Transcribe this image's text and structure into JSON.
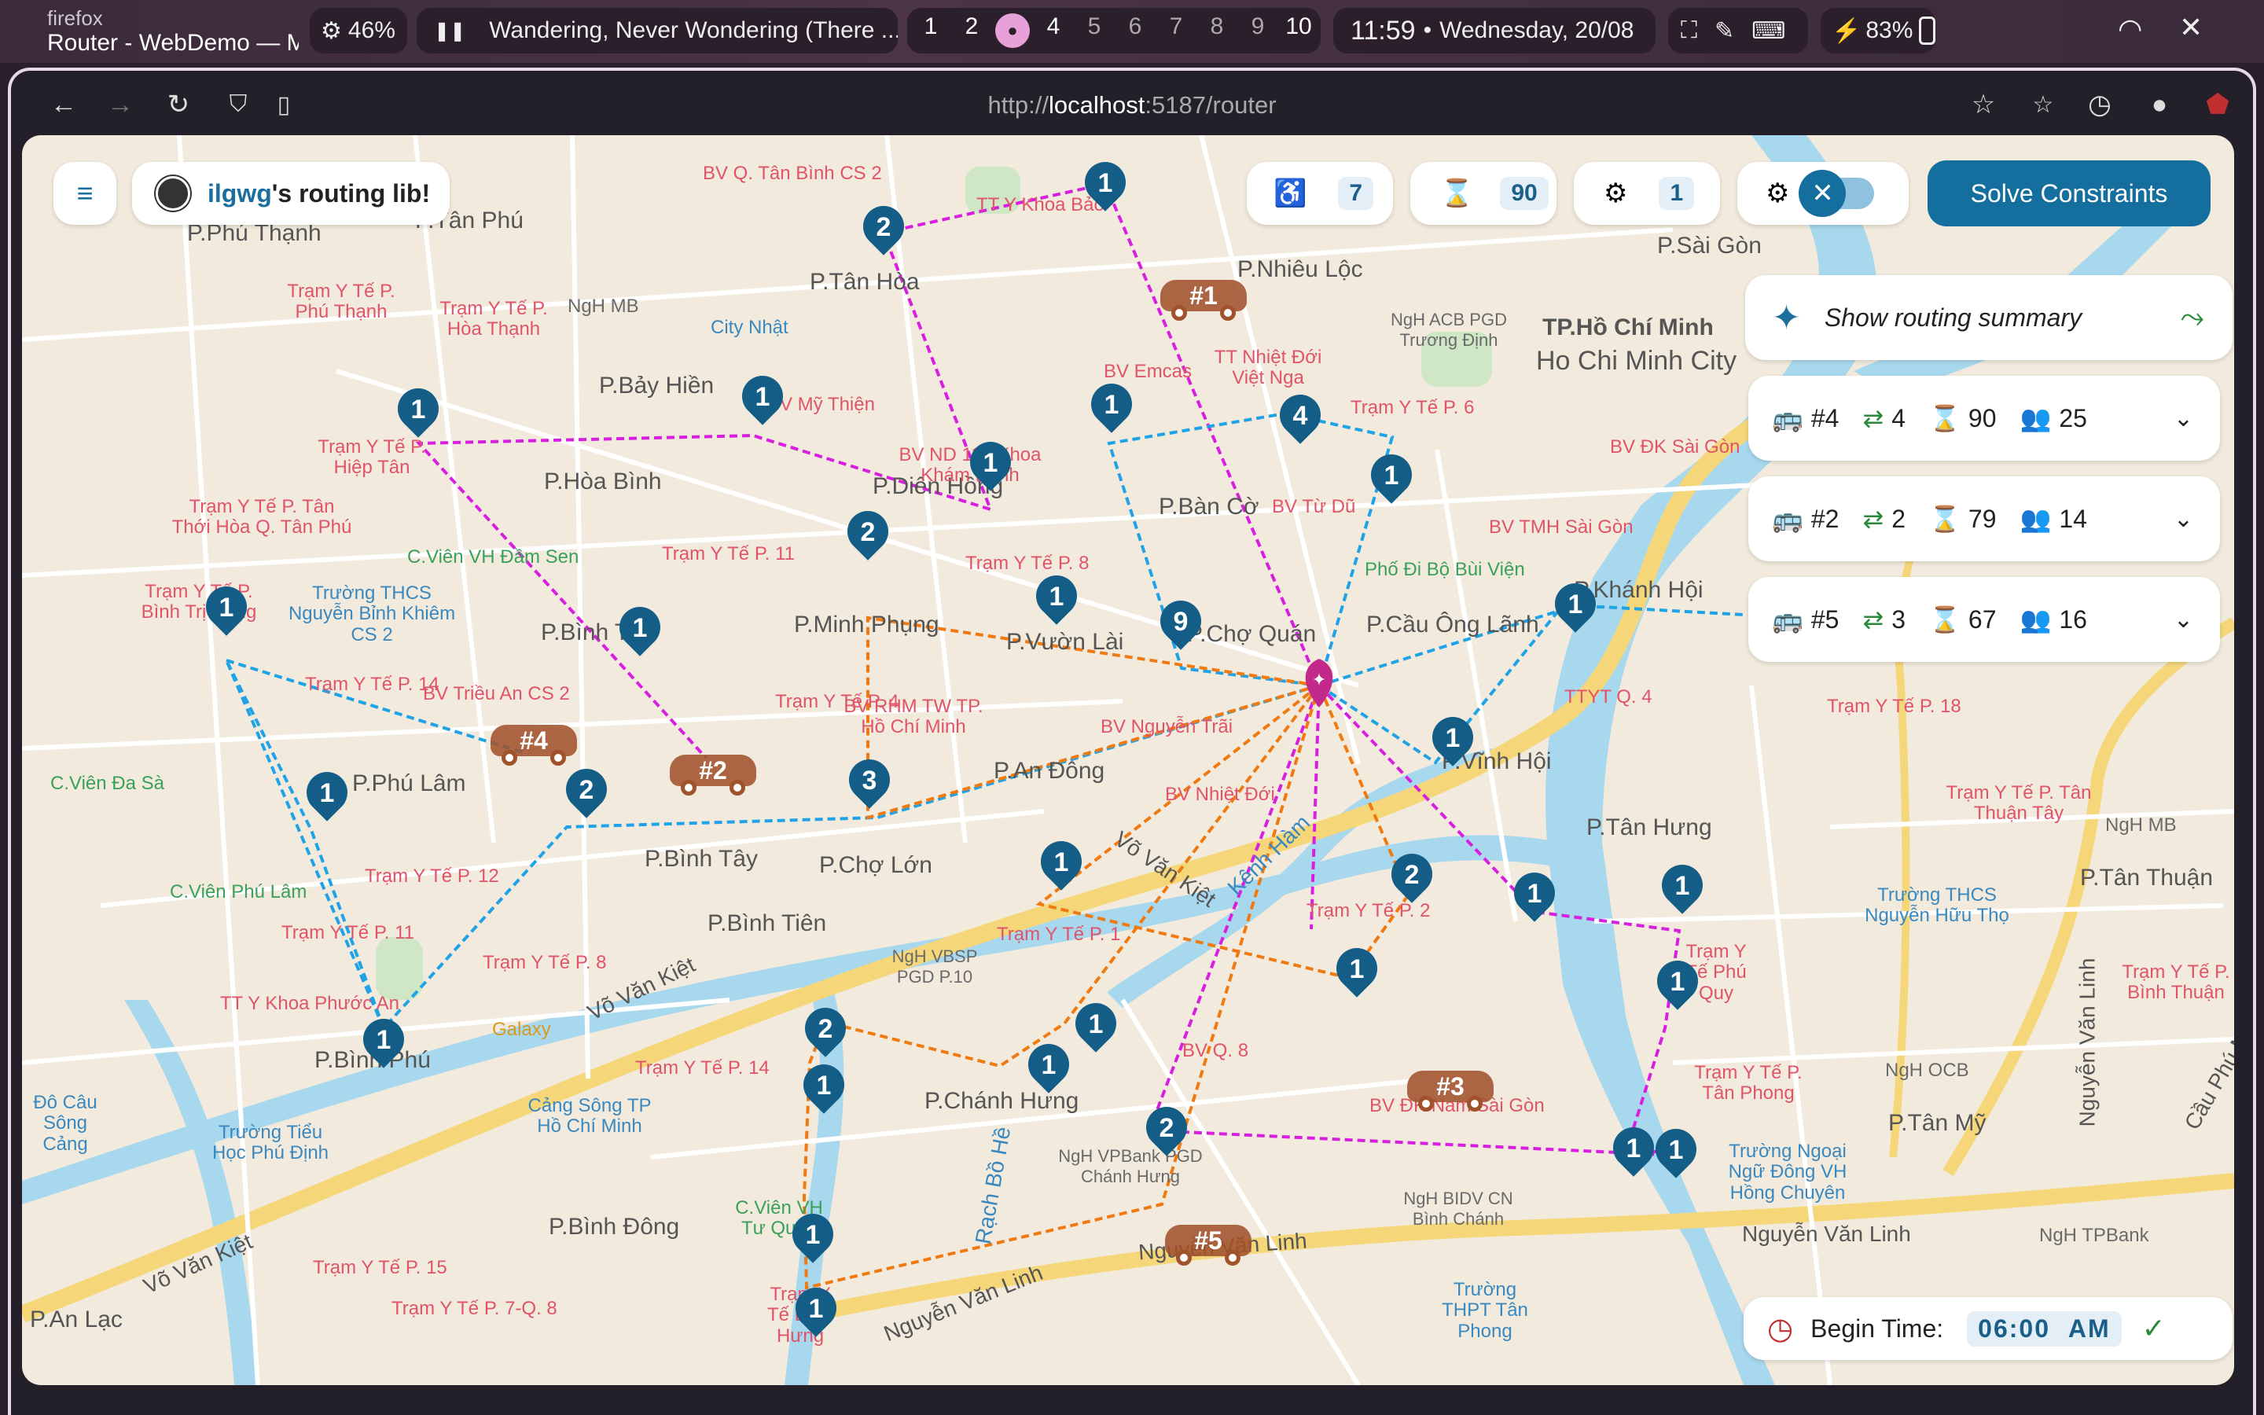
{
  "topbar": {
    "app_name": "firefox",
    "window_title": "Router - WebDemo — Mozilla Firefox",
    "cpu": "46%",
    "media_title": "Wandering, Never Wondering (There ...",
    "workspaces": [
      "1",
      "2",
      "3",
      "4",
      "5",
      "6",
      "7",
      "8",
      "9",
      "10"
    ],
    "active_workspace": "3",
    "time": "11:59",
    "date": "Wednesday, 20/08",
    "battery": "83%"
  },
  "browser": {
    "url_prefix": "http://",
    "url_host": "localhost",
    "url_rest": ":5187/router"
  },
  "app": {
    "brand_user": "ilgwg",
    "brand_rest": "'s routing lib!",
    "stats": {
      "passengers": "7",
      "time_limit": "90",
      "vehicles": "1"
    },
    "solve_label": "Solve Constraints",
    "summary_label": "Show routing summary",
    "routes": [
      {
        "id": "#4",
        "transfers": "4",
        "duration": "90",
        "riders": "25"
      },
      {
        "id": "#2",
        "transfers": "2",
        "duration": "79",
        "riders": "14"
      },
      {
        "id": "#5",
        "transfers": "3",
        "duration": "67",
        "riders": "16"
      }
    ],
    "begin_time_label": "Begin Time:",
    "begin_time": "06:00",
    "begin_ampm": "AM"
  },
  "map": {
    "districts": [
      "P.Phú Thạnh",
      "P.Tân Phú",
      "P.Tân Hòa",
      "P.Nhiêu Lộc",
      "P.Sài Gòn",
      "P.Bảy Hiền",
      "P.Hòa Bình",
      "P.Diên Hồng",
      "P.Bàn Cờ",
      "TP.Hồ Chí Minh",
      "Ho Chi Minh City",
      "P.Bình Trị",
      "P.Minh Phụng",
      "P.Vườn Lài",
      "P.Chợ Quán",
      "P.Cầu Ông Lãnh",
      "P.Khánh Hội",
      "P.Phú Lâm",
      "P.An Đông",
      "P.Bình Tây",
      "P.Chợ Lớn",
      "P.Vĩnh Hội",
      "P.Tân Hưng",
      "P.Tân Thuận",
      "P.Bình Tiên",
      "P.Bình Phú",
      "P.Chánh Hưng",
      "P.Tân Mỹ",
      "P.Bình Đông",
      "P.An Lạc"
    ],
    "roads": [
      "Võ Văn Kiệt",
      "Nguyễn Văn Linh",
      "Võ Văn Kiệt",
      "Nguyễn Văn Linh",
      "Nguyễn Văn Linh",
      "Võ Văn Kiệt",
      "Kênh Hàm",
      "Rạch Bồ Hề",
      "Cầu Phú Mỹ",
      "Nguyễn Văn Linh"
    ],
    "pois": [
      "BV Q. Tân Bình CS 2",
      "TT Y Khoa Bảo",
      "Trạm Y Tế P. Phú Thạnh",
      "Trạm Y Tế P. Hòa Thạnh",
      "NgH MB",
      "City Nhật",
      "BV Emcas",
      "TT Nhiệt Đới Việt Nga",
      "NgH ACB PGD Trương Định",
      "Trạm Y Tế P. Hiệp Tân",
      "Trạm Y Tế P. Tân Thới Hòa Q. Tân Phú",
      "Trạm Y Tế P. Bình Trị Đông",
      "Trường THCS Nguyễn Bỉnh Khiêm CS 2",
      "C.Viên VH Đầm Sen",
      "BV Mỹ Thiện",
      "BV ND 115 Khoa Khám Bệnh",
      "Trạm Y Tế P. 11",
      "Trạm Y Tế P. 8",
      "BV Từ Dũ",
      "Phố Đi Bộ Bùi Viện",
      "BV TMH Sài Gòn",
      "BV ĐK Sài Gòn",
      "Trạm Y Tế P. 6",
      "Trạm Y Tế P. 14",
      "BV Triều An CS 2",
      "Trạm Y Tế P. 4",
      "BV RHM TW TP. Hồ Chí Minh",
      "BV Nguyễn Trãi",
      "TTYT Q. 4",
      "Trạm Y Tế P. 18",
      "C.Viên Đa Sà",
      "BV Nhiệt Đới",
      "Trạm Y Tế P. Tân Thuận Tây",
      "C.Viên Phú Lâm",
      "Trạm Y Tế P. 12",
      "Trạm Y Tế P. 11",
      "TT Y Khoa Phước An",
      "Trạm Y Tế P. 8",
      "Galaxy",
      "Trạm Y Tế P. 2",
      "Trường THCS Nguyễn Hữu Thọ",
      "Trạm Y Tế Phú Quy",
      "BV Q. 8",
      "Trạm Y Tế P. 1",
      "NgH VBSP PGD P.10",
      "Trạm Y Tế P. 14",
      "Cảng Sông TP Hồ Chí Minh",
      "Trường Tiểu Học Phú Định",
      "BV ĐK Nam Sài Gòn",
      "Trạm Y Tế P. Tân Phong",
      "NgH OCB",
      "Trường Ngoại Ngữ Đông VH Hồng Chuyên",
      "NgH VPBank PGD Chánh Hưng",
      "NgH BIDV CN Bình Chánh",
      "Trường THPT Tân Phong",
      "C.Viên VH Tư Quan",
      "Trạm Y Tế P. 15",
      "Trạm Y Tế P. 7-Q. 8",
      "Trạm Y Tế Bình Hưng",
      "NgH TPBank",
      "Trạm Y Tế P. Bình Thuận",
      "NgH MB",
      "Đô Câu Sông Cảng"
    ],
    "cars": [
      "#1",
      "#4",
      "#2",
      "#3",
      "#5"
    ]
  },
  "colors": {
    "route_magenta": "#d81fe0",
    "route_blue": "#1fa3e6",
    "route_orange": "#f07a12",
    "pin": "#145d86",
    "accent": "#156f9e",
    "depot": "#c2298a"
  }
}
